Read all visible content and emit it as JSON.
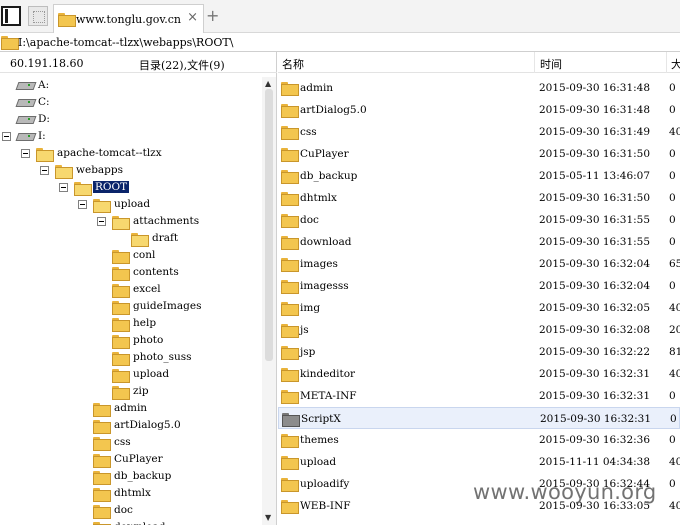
{
  "tabbar": {
    "tab_title": "www.tonglu.gov.cn",
    "close_glyph": "×",
    "new_tab_glyph": "+"
  },
  "path": {
    "value": "I:\\apache-tomcat--tlzx\\webapps\\ROOT\\"
  },
  "left": {
    "ip": "60.191.18.60",
    "count_label": "目录(22),文件(9)",
    "tree": [
      {
        "label": "A:",
        "type": "drive"
      },
      {
        "label": "C:",
        "type": "drive"
      },
      {
        "label": "D:",
        "type": "drive"
      },
      {
        "label": "I:",
        "type": "drive"
      },
      {
        "label": "apache-tomcat--tlzx",
        "type": "folder"
      },
      {
        "label": "webapps",
        "type": "folder"
      },
      {
        "label": "ROOT",
        "type": "folder"
      },
      {
        "label": "upload",
        "type": "folder"
      },
      {
        "label": "attachments",
        "type": "folder"
      },
      {
        "label": "draft",
        "type": "folder"
      },
      {
        "label": "conl",
        "type": "folder"
      },
      {
        "label": "contents",
        "type": "folder"
      },
      {
        "label": "excel",
        "type": "folder"
      },
      {
        "label": "guideImages",
        "type": "folder"
      },
      {
        "label": "help",
        "type": "folder"
      },
      {
        "label": "photo",
        "type": "folder"
      },
      {
        "label": "photo_suss",
        "type": "folder"
      },
      {
        "label": "upload",
        "type": "folder"
      },
      {
        "label": "zip",
        "type": "folder"
      },
      {
        "label": "admin",
        "type": "folder"
      },
      {
        "label": "artDialog5.0",
        "type": "folder"
      },
      {
        "label": "css",
        "type": "folder"
      },
      {
        "label": "CuPlayer",
        "type": "folder"
      },
      {
        "label": "db_backup",
        "type": "folder"
      },
      {
        "label": "dhtmlx",
        "type": "folder"
      },
      {
        "label": "doc",
        "type": "folder"
      },
      {
        "label": "download",
        "type": "folder"
      }
    ]
  },
  "right": {
    "columns": {
      "name": "名称",
      "time": "时间",
      "size": "大"
    },
    "rows": [
      {
        "name": "admin",
        "time": "2015-09-30 16:31:48",
        "size": "0"
      },
      {
        "name": "artDialog5.0",
        "time": "2015-09-30 16:31:48",
        "size": "0"
      },
      {
        "name": "css",
        "time": "2015-09-30 16:31:49",
        "size": "40"
      },
      {
        "name": "CuPlayer",
        "time": "2015-09-30 16:31:50",
        "size": "0"
      },
      {
        "name": "db_backup",
        "time": "2015-05-11 13:46:07",
        "size": "0"
      },
      {
        "name": "dhtmlx",
        "time": "2015-09-30 16:31:50",
        "size": "0"
      },
      {
        "name": "doc",
        "time": "2015-09-30 16:31:55",
        "size": "0"
      },
      {
        "name": "download",
        "time": "2015-09-30 16:31:55",
        "size": "0"
      },
      {
        "name": "images",
        "time": "2015-09-30 16:32:04",
        "size": "65"
      },
      {
        "name": "imagesss",
        "time": "2015-09-30 16:32:04",
        "size": "0"
      },
      {
        "name": "img",
        "time": "2015-09-30 16:32:05",
        "size": "40"
      },
      {
        "name": "js",
        "time": "2015-09-30 16:32:08",
        "size": "20"
      },
      {
        "name": "jsp",
        "time": "2015-09-30 16:32:22",
        "size": "81"
      },
      {
        "name": "kindeditor",
        "time": "2015-09-30 16:32:31",
        "size": "40"
      },
      {
        "name": "META-INF",
        "time": "2015-09-30 16:32:31",
        "size": "0"
      },
      {
        "name": "ScriptX",
        "time": "2015-09-30 16:32:31",
        "size": "0"
      },
      {
        "name": "themes",
        "time": "2015-09-30 16:32:36",
        "size": "0"
      },
      {
        "name": "upload",
        "time": "2015-11-11 04:34:38",
        "size": "40"
      },
      {
        "name": "uploadify",
        "time": "2015-09-30 16:32:44",
        "size": "0"
      },
      {
        "name": "WEB-INF",
        "time": "2015-09-30 16:33:05",
        "size": "40"
      }
    ]
  },
  "watermark": "www.wooyun.org",
  "colors": {
    "selection": "#0a246a",
    "hover_row": "#eaf0fb",
    "folder": "#f3c64f"
  }
}
